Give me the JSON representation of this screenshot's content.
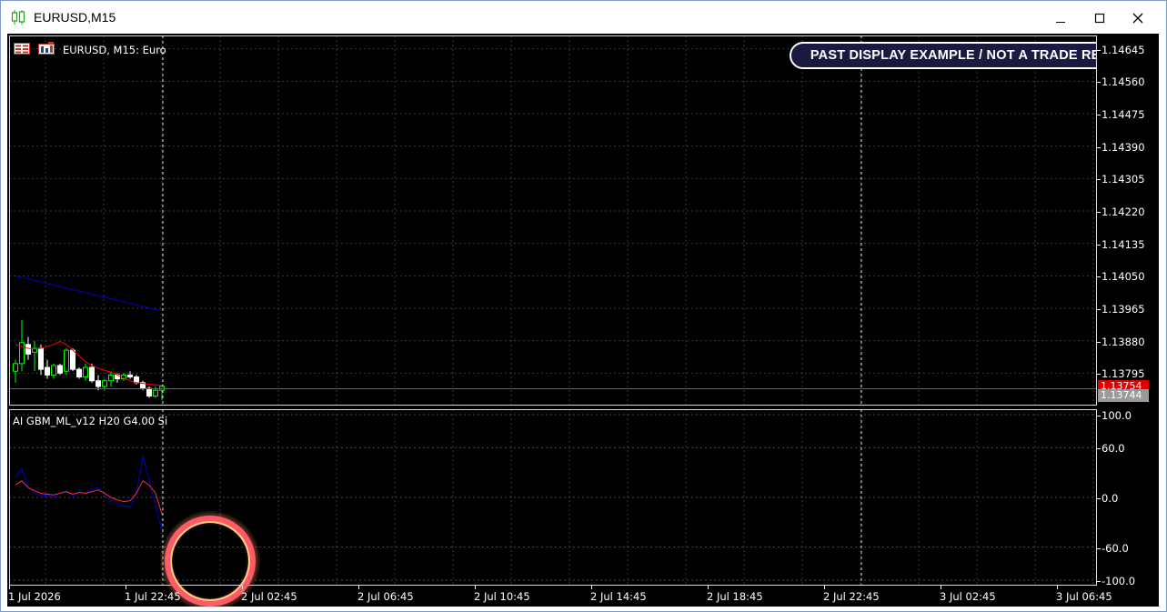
{
  "window": {
    "title": "EURUSD,M15",
    "controls": [
      "minimize",
      "maximize",
      "close"
    ]
  },
  "chart": {
    "header_label": "EURUSD, M15:  Euro",
    "badge_text": "PAST DISPLAY EXAMPLE  /  NOT A TRADE RESULT",
    "indicator_label": "AI GBM_ML_v12 H20 G4.00 Si",
    "current_price_red": "1.13754",
    "current_price_gray": "1.13744",
    "colors": {
      "background": "#000000",
      "bull_candle": "#00ff00",
      "bear_candle": "#ffffff",
      "red_line": "#ff0000",
      "blue_line": "#0000cc"
    }
  },
  "chart_data": {
    "type": "line",
    "symbol": "EURUSD",
    "timeframe": "M15",
    "price_axis_ticks": [
      "1.14645",
      "1.14560",
      "1.14475",
      "1.14390",
      "1.14305",
      "1.14220",
      "1.14135",
      "1.14050",
      "1.13965",
      "1.13880",
      "1.13795"
    ],
    "indicator_axis_ticks": [
      "100.0",
      "60.0",
      "0.0",
      "-60.0",
      "-100.0"
    ],
    "time_axis_ticks": [
      "1 Jul 2026",
      "1 Jul 22:45",
      "2 Jul 02:45",
      "2 Jul 06:45",
      "2 Jul 10:45",
      "2 Jul 14:45",
      "2 Jul 18:45",
      "2 Jul 22:45",
      "3 Jul 02:45",
      "3 Jul 06:45"
    ],
    "price_ylim": [
      1.1371,
      1.1468
    ],
    "indicator_ylim": [
      -100,
      100
    ],
    "candles": [
      {
        "o": 1.138,
        "h": 1.1383,
        "l": 1.1377,
        "c": 1.1382
      },
      {
        "o": 1.1382,
        "h": 1.13935,
        "l": 1.138,
        "c": 1.13875
      },
      {
        "o": 1.1387,
        "h": 1.1389,
        "l": 1.1383,
        "c": 1.13845
      },
      {
        "o": 1.1385,
        "h": 1.1388,
        "l": 1.138,
        "c": 1.1386
      },
      {
        "o": 1.1386,
        "h": 1.1387,
        "l": 1.1379,
        "c": 1.13805
      },
      {
        "o": 1.1381,
        "h": 1.1383,
        "l": 1.1378,
        "c": 1.1379
      },
      {
        "o": 1.1379,
        "h": 1.1382,
        "l": 1.1378,
        "c": 1.13815
      },
      {
        "o": 1.13815,
        "h": 1.1382,
        "l": 1.1379,
        "c": 1.13795
      },
      {
        "o": 1.138,
        "h": 1.1386,
        "l": 1.1379,
        "c": 1.13855
      },
      {
        "o": 1.13855,
        "h": 1.1386,
        "l": 1.138,
        "c": 1.13805
      },
      {
        "o": 1.13805,
        "h": 1.1381,
        "l": 1.1378,
        "c": 1.13785
      },
      {
        "o": 1.13785,
        "h": 1.1382,
        "l": 1.13775,
        "c": 1.1381
      },
      {
        "o": 1.1381,
        "h": 1.1382,
        "l": 1.1377,
        "c": 1.13775
      },
      {
        "o": 1.13775,
        "h": 1.1379,
        "l": 1.1375,
        "c": 1.1376
      },
      {
        "o": 1.1376,
        "h": 1.1378,
        "l": 1.1375,
        "c": 1.13775
      },
      {
        "o": 1.13775,
        "h": 1.138,
        "l": 1.1376,
        "c": 1.1379
      },
      {
        "o": 1.1379,
        "h": 1.13795,
        "l": 1.1377,
        "c": 1.1378
      },
      {
        "o": 1.1378,
        "h": 1.13795,
        "l": 1.13775,
        "c": 1.1379
      },
      {
        "o": 1.1379,
        "h": 1.138,
        "l": 1.1378,
        "c": 1.13785
      },
      {
        "o": 1.13785,
        "h": 1.1379,
        "l": 1.13765,
        "c": 1.1377
      },
      {
        "o": 1.1377,
        "h": 1.13775,
        "l": 1.1375,
        "c": 1.13755
      },
      {
        "o": 1.13755,
        "h": 1.1376,
        "l": 1.1373,
        "c": 1.13735
      },
      {
        "o": 1.13735,
        "h": 1.1376,
        "l": 1.1373,
        "c": 1.1375
      },
      {
        "o": 1.1375,
        "h": 1.13765,
        "l": 1.13725,
        "c": 1.1376
      }
    ],
    "series": [
      {
        "pane": "price",
        "values": [
          1.1387,
          1.13865,
          1.1386,
          1.13858,
          1.1386,
          1.13865,
          1.1387,
          1.13878,
          1.1387,
          1.13855,
          1.1384,
          1.13825,
          1.13815,
          1.13808,
          1.13802,
          1.13798,
          1.1379,
          1.13782,
          1.13775,
          1.1377,
          1.13768,
          1.13766,
          1.13764,
          1.13762
        ]
      },
      {
        "pane": "price",
        "values": [
          1.1405,
          1.14046,
          1.14042,
          1.14038,
          1.14034,
          1.1403,
          1.14026,
          1.14022,
          1.14018,
          1.14014,
          1.1401,
          1.14006,
          1.14002,
          1.13998,
          1.13994,
          1.1399,
          1.13986,
          1.13982,
          1.13978,
          1.13974,
          1.1397,
          1.13966,
          1.13962,
          1.13958
        ]
      },
      {
        "pane": "indicator",
        "values": [
          25,
          35,
          12,
          5,
          2,
          3,
          0,
          5,
          8,
          2,
          7,
          5,
          10,
          12,
          3,
          -5,
          -8,
          -10,
          -12,
          5,
          50,
          20,
          -10,
          -40
        ]
      },
      {
        "pane": "indicator",
        "values": [
          15,
          20,
          12,
          8,
          5,
          4,
          3,
          5,
          7,
          4,
          6,
          5,
          7,
          9,
          5,
          0,
          -3,
          -5,
          -4,
          5,
          20,
          15,
          5,
          -20
        ]
      }
    ]
  }
}
